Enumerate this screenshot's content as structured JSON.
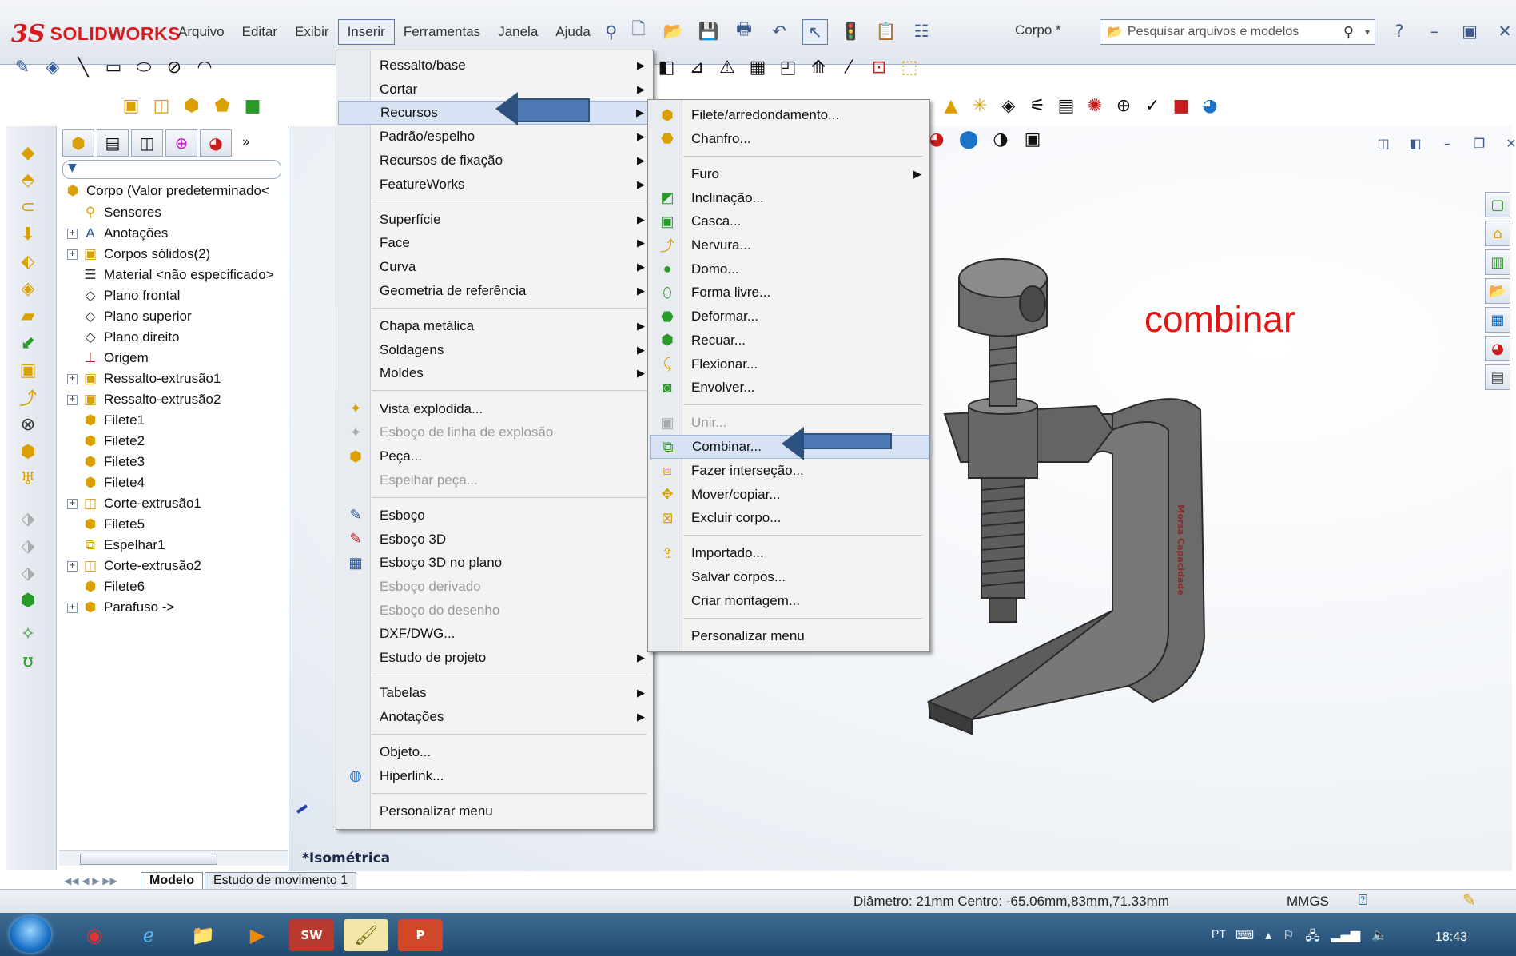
{
  "app": {
    "logo_ds": "3S",
    "logo_text": "SOLIDWORKS",
    "doc_title": "Corpo *",
    "search_placeholder": "Pesquisar arquivos e modelos"
  },
  "menubar": [
    "Arquivo",
    "Editar",
    "Exibir",
    "Inserir",
    "Ferramentas",
    "Janela",
    "Ajuda"
  ],
  "tree": {
    "root": "Corpo  (Valor predeterminado<",
    "items": [
      {
        "label": "Sensores",
        "icon": "sensor-icon",
        "expand": false
      },
      {
        "label": "Anotações",
        "icon": "annotation-icon",
        "expand": true
      },
      {
        "label": "Corpos sólidos(2)",
        "icon": "solid-bodies-icon",
        "expand": true
      },
      {
        "label": "Material <não especificado>",
        "icon": "material-icon",
        "expand": false
      },
      {
        "label": "Plano frontal",
        "icon": "plane-icon",
        "expand": false
      },
      {
        "label": "Plano superior",
        "icon": "plane-icon",
        "expand": false
      },
      {
        "label": "Plano direito",
        "icon": "plane-icon",
        "expand": false
      },
      {
        "label": "Origem",
        "icon": "origin-icon",
        "expand": false
      },
      {
        "label": "Ressalto-extrusão1",
        "icon": "boss-extrude-icon",
        "expand": true
      },
      {
        "label": "Ressalto-extrusão2",
        "icon": "boss-extrude-icon",
        "expand": true
      },
      {
        "label": "Filete1",
        "icon": "fillet-icon",
        "expand": false
      },
      {
        "label": "Filete2",
        "icon": "fillet-icon",
        "expand": false
      },
      {
        "label": "Filete3",
        "icon": "fillet-icon",
        "expand": false
      },
      {
        "label": "Filete4",
        "icon": "fillet-icon",
        "expand": false
      },
      {
        "label": "Corte-extrusão1",
        "icon": "cut-extrude-icon",
        "expand": true
      },
      {
        "label": "Filete5",
        "icon": "fillet-icon",
        "expand": false
      },
      {
        "label": "Espelhar1",
        "icon": "mirror-icon",
        "expand": false
      },
      {
        "label": "Corte-extrusão2",
        "icon": "cut-extrude-icon",
        "expand": true
      },
      {
        "label": "Filete6",
        "icon": "fillet-icon",
        "expand": false
      },
      {
        "label": "Parafuso ->",
        "icon": "part-icon",
        "expand": true
      }
    ]
  },
  "insert_menu": {
    "items": [
      {
        "label": "Ressalto/base",
        "submenu": true
      },
      {
        "label": "Cortar",
        "submenu": true
      },
      {
        "label": "Recursos",
        "submenu": true,
        "hover": true
      },
      {
        "label": "Padrão/espelho",
        "submenu": true
      },
      {
        "label": "Recursos de fixação",
        "submenu": true
      },
      {
        "label": "FeatureWorks",
        "submenu": true
      },
      {
        "label": "Superfície",
        "submenu": true
      },
      {
        "label": "Face",
        "submenu": true
      },
      {
        "label": "Curva",
        "submenu": true
      },
      {
        "label": "Geometria de referência",
        "submenu": true
      },
      {
        "label": "Chapa metálica",
        "submenu": true
      },
      {
        "label": "Soldagens",
        "submenu": true
      },
      {
        "label": "Moldes",
        "submenu": true
      },
      {
        "label": "Vista explodida...",
        "icon": "exploded-view-icon"
      },
      {
        "label": "Esboço de linha de explosão",
        "disabled": true,
        "icon": "explode-line-icon"
      },
      {
        "label": "Peça...",
        "icon": "insert-part-icon"
      },
      {
        "label": "Espelhar peça...",
        "disabled": true
      },
      {
        "label": "Esboço",
        "icon": "sketch-icon"
      },
      {
        "label": "Esboço 3D",
        "icon": "sketch-3d-icon"
      },
      {
        "label": "Esboço 3D no plano",
        "icon": "sketch-3d-plane-icon"
      },
      {
        "label": "Esboço derivado",
        "disabled": true
      },
      {
        "label": "Esboço do desenho",
        "disabled": true
      },
      {
        "label": "DXF/DWG..."
      },
      {
        "label": "Estudo de projeto",
        "submenu": true
      },
      {
        "label": "Tabelas",
        "submenu": true
      },
      {
        "label": "Anotações",
        "submenu": true
      },
      {
        "label": "Objeto..."
      },
      {
        "label": "Hiperlink...",
        "icon": "globe-icon"
      },
      {
        "label": "Personalizar menu"
      }
    ]
  },
  "features_menu": {
    "items": [
      {
        "label": "Filete/arredondamento...",
        "icon": "fillet-icon"
      },
      {
        "label": "Chanfro...",
        "icon": "chamfer-icon"
      },
      {
        "label": "Furo",
        "submenu": true
      },
      {
        "label": "Inclinação...",
        "icon": "draft-icon"
      },
      {
        "label": "Casca...",
        "icon": "shell-icon"
      },
      {
        "label": "Nervura...",
        "icon": "rib-icon"
      },
      {
        "label": "Domo...",
        "icon": "dome-icon"
      },
      {
        "label": "Forma livre...",
        "icon": "freeform-icon"
      },
      {
        "label": "Deformar...",
        "icon": "deform-icon"
      },
      {
        "label": "Recuar...",
        "icon": "indent-icon"
      },
      {
        "label": "Flexionar...",
        "icon": "flex-icon"
      },
      {
        "label": "Envolver...",
        "icon": "wrap-icon"
      },
      {
        "label": "Unir...",
        "disabled": true,
        "icon": "join-icon"
      },
      {
        "label": "Combinar...",
        "hover": true,
        "icon": "combine-icon"
      },
      {
        "label": "Fazer interseção...",
        "icon": "intersect-icon"
      },
      {
        "label": "Mover/copiar...",
        "icon": "move-copy-icon"
      },
      {
        "label": "Excluir corpo...",
        "icon": "delete-body-icon"
      },
      {
        "label": "Importado...",
        "icon": "imported-icon"
      },
      {
        "label": "Salvar corpos..."
      },
      {
        "label": "Criar montagem..."
      },
      {
        "label": "Personalizar menu"
      }
    ]
  },
  "graphics": {
    "annotation": "combinar",
    "view_label": "*Isométrica",
    "part_engraving": "Morsa Capacidade"
  },
  "model_tabs": [
    "Modelo",
    "Estudo de movimento 1"
  ],
  "status": {
    "text": "Diâmetro: 21mm  Centro: -65.06mm,83mm,71.33mm",
    "units": "MMGS"
  },
  "taskbar": {
    "lang": "PT",
    "time": "18:43"
  },
  "colors": {
    "accent": "#4c79b4",
    "annotation": "#e11616",
    "menu_hover": "#d7e3f4"
  }
}
